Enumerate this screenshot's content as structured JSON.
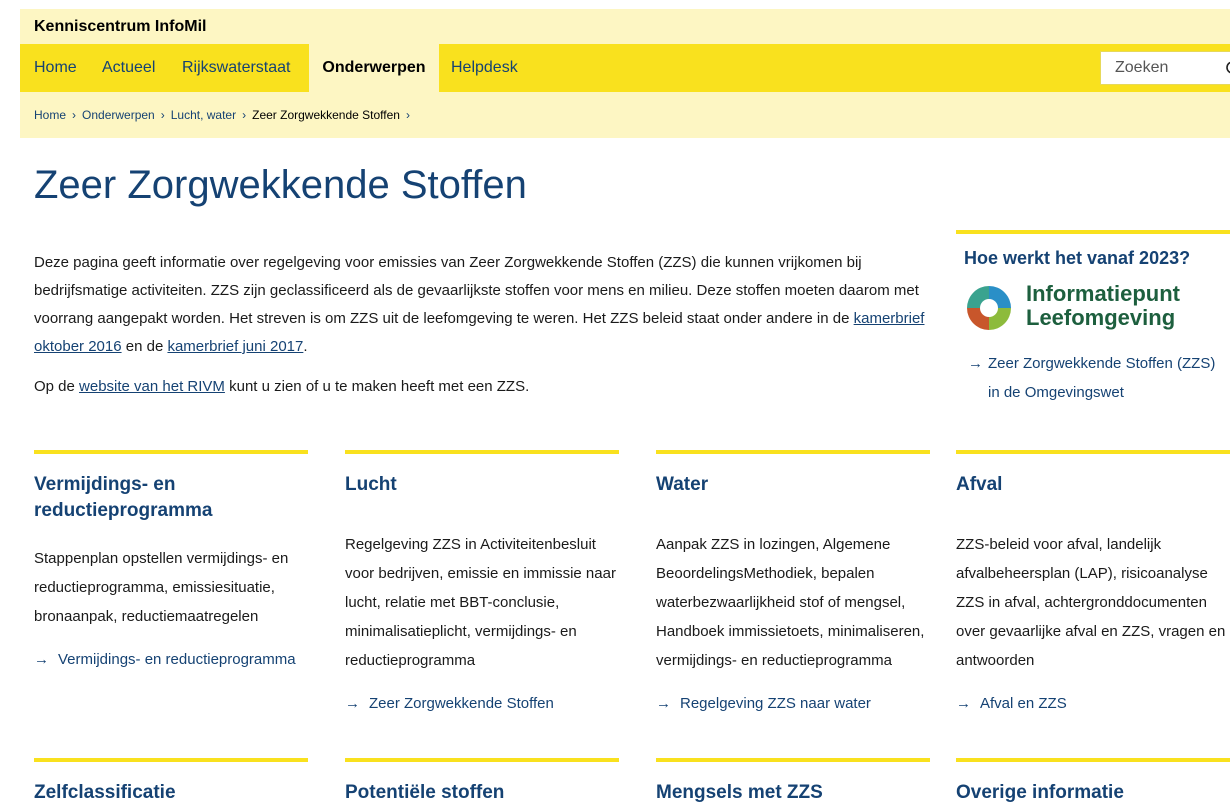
{
  "site": {
    "title": "Kenniscentrum InfoMil"
  },
  "nav": {
    "items": [
      {
        "label": "Home"
      },
      {
        "label": "Actueel"
      },
      {
        "label": "Rijkswaterstaat"
      },
      {
        "label": "Onderwerpen",
        "active": true
      },
      {
        "label": "Helpdesk"
      }
    ],
    "search_placeholder": "Zoeken"
  },
  "breadcrumb": {
    "items": [
      "Home",
      "Onderwerpen",
      "Lucht, water",
      "Zeer Zorgwekkende Stoffen"
    ],
    "separator": "›"
  },
  "page": {
    "title": "Zeer Zorgwekkende Stoffen",
    "intro1_before": "Deze pagina geeft informatie over regelgeving voor emissies van Zeer Zorgwekkende Stoffen (ZZS) die kunnen vrijkomen bij bedrijfsmatige activiteiten. ZZS zijn geclassificeerd als de gevaarlijkste stoffen voor mens en milieu. Deze stoffen moeten daarom met voorrang aangepakt worden. Het streven is om ZZS uit de leefomgeving te weren. Het ZZS beleid staat onder andere in de ",
    "intro1_link1": "kamerbrief oktober 2016",
    "intro1_mid": " en de ",
    "intro1_link2": "kamerbrief juni 2017",
    "intro1_after": ".",
    "intro2_before": "Op de ",
    "intro2_link": "website van het RIVM",
    "intro2_after": " kunt u zien of u te maken heeft met een ZZS."
  },
  "aside": {
    "title": "Hoe werkt het vanaf 2023?",
    "logo_line1": "Informatiepunt",
    "logo_line2": "Leefomgeving",
    "link": "Zeer Zorgwekkende Stoffen (ZZS) in de Omgevingswet",
    "arrow": "→"
  },
  "cards": [
    {
      "title": "Vermijdings- en reductieprogramma",
      "text": "Stappenplan opstellen vermijdings- en reductieprogramma, emissiesituatie, bronaanpak, reductiemaatregelen",
      "link": "Vermijdings- en reductieprogramma"
    },
    {
      "title": "Lucht",
      "text": "Regelgeving ZZS in Activiteitenbesluit voor bedrijven, emissie en immissie naar lucht, relatie met BBT-conclusie, minimalisatieplicht, vermijdings- en reductieprogramma",
      "link": "Zeer Zorgwekkende Stoffen"
    },
    {
      "title": "Water",
      "text": "Aanpak ZZS in lozingen, Algemene BeoordelingsMethodiek, bepalen waterbezwaarlijkheid stof of mengsel, Handboek immissietoets, minimaliseren, vermijdings- en reductieprogramma",
      "link": "Regelgeving ZZS naar water"
    },
    {
      "title": "Afval",
      "text": "ZZS-beleid voor afval, landelijk afvalbeheersplan (LAP), risicoanalyse ZZS in afval, achtergronddocumenten over gevaarlijke afval en ZZS, vragen en antwoorden",
      "link": "Afval en ZZS"
    }
  ],
  "cards_row2": [
    {
      "title": "Zelfclassificatie"
    },
    {
      "title": "Potentiële stoffen"
    },
    {
      "title": "Mengsels met ZZS"
    },
    {
      "title": "Overige informatie"
    }
  ],
  "arrow": "→",
  "colors": {
    "brand_yellow": "#f9e11e",
    "light_yellow": "#fdf6c3",
    "link_blue": "#154273",
    "iplo_green": "#1d5f3e"
  }
}
